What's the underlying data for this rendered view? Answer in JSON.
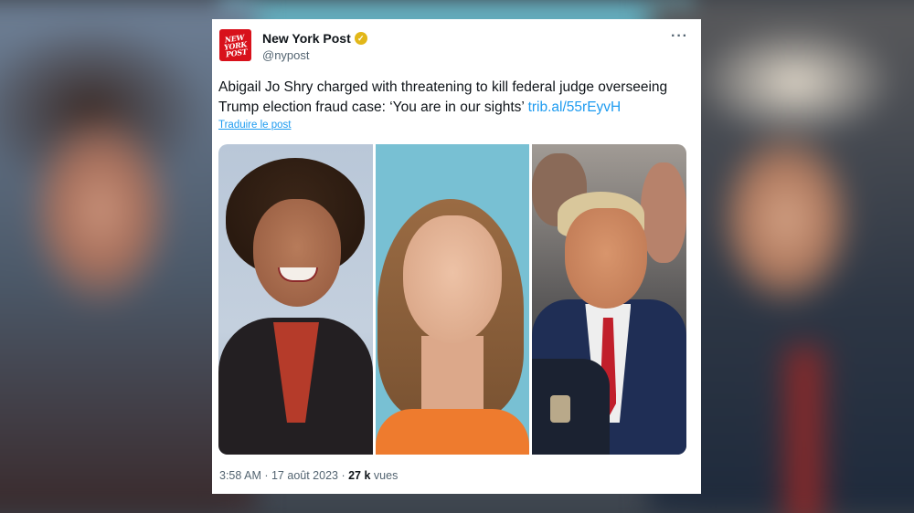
{
  "account": {
    "logo_text": "NEW YORK POST",
    "name": "New York Post",
    "handle": "@nypost",
    "more_label": "···"
  },
  "tweet": {
    "text": "Abigail Jo Shry charged with threatening to kill federal judge overseeing Trump election fraud case: ‘You are in our sights’ ",
    "link": "trib.al/55rEyvH",
    "translate_label": "Traduire le post",
    "time": "3:58 AM",
    "date": "17 août 2023",
    "separator": " · ",
    "views_count": "27 k",
    "views_label": " vues"
  },
  "colors": {
    "brand_red": "#d8111b",
    "link_blue": "#1d9bf0",
    "verified_gold": "#e2b719"
  },
  "photos": [
    "judge-portrait",
    "mugshot-photo",
    "courtroom-photo"
  ]
}
